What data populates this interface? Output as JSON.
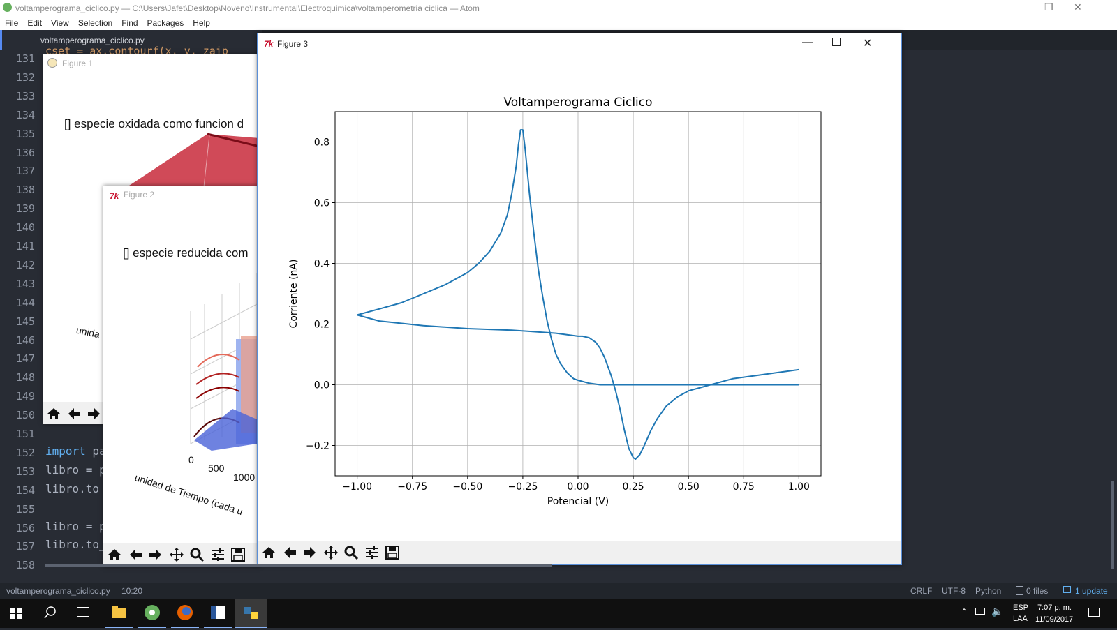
{
  "atom": {
    "window_title": "voltamperograma_ciclico.py — C:\\Users\\Jafet\\Desktop\\Noveno\\Instrumental\\Electroquimica\\voltamperometria ciclica — Atom",
    "menu": [
      "File",
      "Edit",
      "View",
      "Selection",
      "Find",
      "Packages",
      "Help"
    ],
    "tab": "voltamperograma_ciclico.py",
    "partial_code_top": "cset = ax.contourf(x, y, zaip",
    "line_numbers": [
      "131",
      "132",
      "133",
      "134",
      "135",
      "136",
      "137",
      "138",
      "139",
      "140",
      "141",
      "142",
      "143",
      "144",
      "145",
      "146",
      "147",
      "148",
      "149",
      "150",
      "151",
      "152",
      "153",
      "154",
      "155",
      "156",
      "157",
      "158"
    ],
    "code_lines": [
      {
        "line": "152",
        "kw": "import",
        "rest": " pa"
      },
      {
        "line": "153",
        "kw": "",
        "rest": "libro = p"
      },
      {
        "line": "154",
        "kw": "",
        "rest": "libro.to_"
      },
      {
        "line": "156",
        "kw": "",
        "rest": "libro = p"
      },
      {
        "line": "157",
        "kw": "",
        "rest": "libro.to_"
      }
    ]
  },
  "status": {
    "file": "voltamperograma_ciclico.py",
    "cursor": "10:20",
    "line_ending": "CRLF",
    "encoding": "UTF-8",
    "grammar": "Python",
    "git": "0 files",
    "update": "1 update"
  },
  "taskbar": {
    "lang": "ESP",
    "layout": "LAA",
    "time": "7:07 p. m.",
    "date": "11/09/2017"
  },
  "figure1": {
    "title": "Figure 1",
    "plot_title": "[] especie oxidada como funcion d",
    "axis_fragment": "unida"
  },
  "figure2": {
    "title": "Figure 2",
    "plot_title": "[] especie reducida com",
    "xlabel": "unidad de Tiempo (cada u",
    "ticks": [
      "0",
      "500",
      "1000"
    ]
  },
  "figure3": {
    "title": "Figure 3"
  },
  "toolbar_icons": [
    "home-icon",
    "back-arrow-icon",
    "forward-arrow-icon",
    "pan-icon",
    "zoom-icon",
    "configure-subplots-icon",
    "save-icon"
  ],
  "colors": {
    "series": "#1f77b4",
    "atom_accent": "#568af2"
  },
  "chart_data": {
    "type": "line",
    "title": "Voltamperograma Ciclico",
    "xlabel": "Potencial (V)",
    "ylabel": "Corriente (nA)",
    "xlim": [
      -1.1,
      1.1
    ],
    "ylim": [
      -0.3,
      0.9
    ],
    "xticks": [
      -1.0,
      -0.75,
      -0.5,
      -0.25,
      0.0,
      0.25,
      0.5,
      0.75,
      1.0
    ],
    "xtick_labels": [
      "−1.00",
      "−0.75",
      "−0.50",
      "−0.25",
      "0.00",
      "0.25",
      "0.50",
      "0.75",
      "1.00"
    ],
    "yticks": [
      -0.2,
      0.0,
      0.2,
      0.4,
      0.6,
      0.8
    ],
    "ytick_labels": [
      "−0.2",
      "0.0",
      "0.2",
      "0.4",
      "0.6",
      "0.8"
    ],
    "grid": true,
    "series": [
      {
        "x": [
          -1.0,
          -0.9,
          -0.8,
          -0.7,
          -0.6,
          -0.5,
          -0.45,
          -0.4,
          -0.35,
          -0.32,
          -0.3,
          -0.28,
          -0.27,
          -0.26,
          -0.25,
          -0.24,
          -0.22,
          -0.2,
          -0.18,
          -0.16,
          -0.14,
          -0.12,
          -0.1,
          -0.08,
          -0.05,
          -0.02,
          0.0,
          0.05,
          0.1,
          0.15,
          0.2,
          0.3,
          0.4,
          0.5,
          0.6,
          0.7,
          0.8,
          0.9,
          1.0
        ],
        "y": [
          0.23,
          0.25,
          0.27,
          0.3,
          0.33,
          0.37,
          0.4,
          0.44,
          0.5,
          0.56,
          0.63,
          0.72,
          0.79,
          0.84,
          0.84,
          0.78,
          0.63,
          0.5,
          0.38,
          0.29,
          0.21,
          0.15,
          0.1,
          0.07,
          0.04,
          0.02,
          0.015,
          0.005,
          0.0,
          0.0,
          0.0,
          0.0,
          0.0,
          0.0,
          0.0,
          0.0,
          0.0,
          0.0,
          0.0
        ]
      },
      {
        "x": [
          1.0,
          0.9,
          0.8,
          0.7,
          0.6,
          0.55,
          0.5,
          0.45,
          0.4,
          0.36,
          0.33,
          0.3,
          0.28,
          0.26,
          0.25,
          0.23,
          0.21,
          0.19,
          0.17,
          0.15,
          0.12,
          0.1,
          0.08,
          0.05,
          0.02,
          0.0,
          -0.05,
          -0.1,
          -0.2,
          -0.3,
          -0.5,
          -0.7,
          -0.9,
          -1.0
        ],
        "y": [
          0.05,
          0.04,
          0.03,
          0.02,
          0.0,
          -0.01,
          -0.02,
          -0.04,
          -0.07,
          -0.11,
          -0.15,
          -0.2,
          -0.23,
          -0.245,
          -0.24,
          -0.21,
          -0.15,
          -0.08,
          -0.02,
          0.03,
          0.09,
          0.12,
          0.14,
          0.155,
          0.16,
          0.16,
          0.165,
          0.17,
          0.175,
          0.18,
          0.185,
          0.195,
          0.21,
          0.23
        ]
      }
    ]
  }
}
